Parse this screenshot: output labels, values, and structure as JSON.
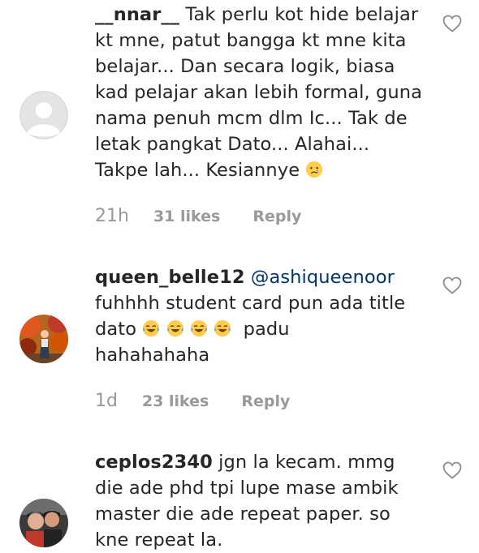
{
  "comments": [
    {
      "username": "__nnar__",
      "mention": "",
      "lines": [
        "Tak perlu kot hide belajar",
        "kt mne, patut bangga kt mne kita",
        "belajar... Dan secara logik, biasa",
        "kad pelajar akan lebih formal, guna",
        "nama penuh mcm dlm Ic... Tak de",
        "letak pangkat Dato... Alahai...",
        "Takpe lah... Kesiannye"
      ],
      "emoji": "crying-face",
      "time": "21h",
      "likes": "31 likes",
      "reply": "Reply",
      "avatar": "default-gray"
    },
    {
      "username": "queen_belle12",
      "mention": "@ashiqueenoor",
      "lines": [
        "fuhhhh student card pun ada title",
        "dato",
        "padu",
        "hahahahaha"
      ],
      "emoji": "face-with-tears-of-joy",
      "time": "1d",
      "likes": "23 likes",
      "reply": "Reply",
      "avatar": "photo-autumn"
    },
    {
      "username": "ceplos2340",
      "mention": "",
      "lines": [
        "jgn la kecam. mmg",
        "die ade phd tpi lupe mase ambik",
        "master die ade repeat paper. so",
        "kne repeat la."
      ],
      "avatar": "photo-couple"
    }
  ],
  "colors": {
    "text": "#262626",
    "meta": "#999999",
    "mention": "#003569",
    "heart": "#8e8e8e"
  }
}
